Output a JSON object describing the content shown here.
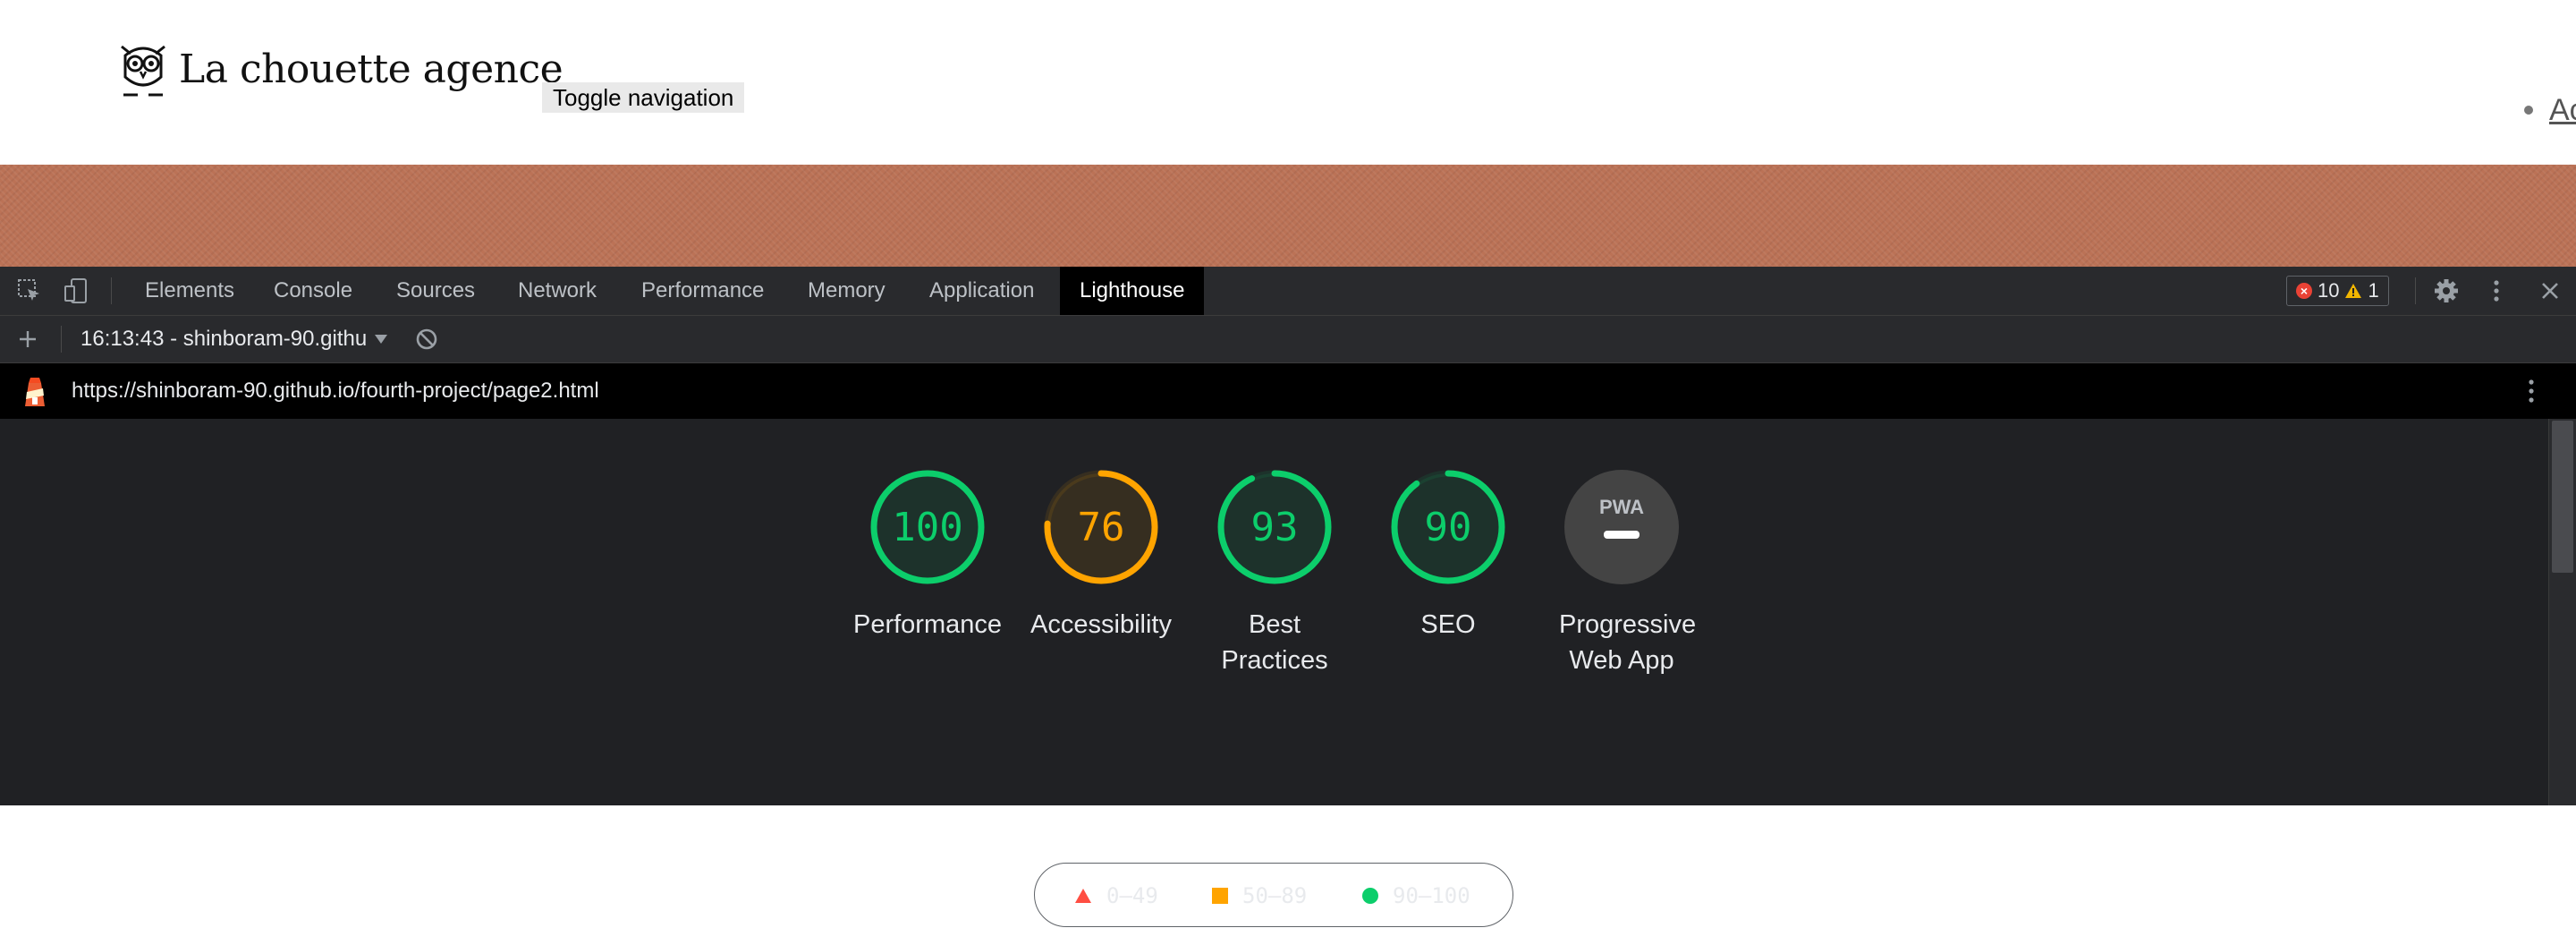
{
  "site": {
    "logo_text": "La chouette agence",
    "toggle_label": "Toggle navigation",
    "nav_partial": "Ac"
  },
  "devtools": {
    "tabs": [
      "Elements",
      "Console",
      "Sources",
      "Network",
      "Performance",
      "Memory",
      "Application",
      "Lighthouse"
    ],
    "active_tab": "Lighthouse",
    "errors": "10",
    "warnings": "1",
    "report_select": "16:13:43 - shinboram-90.github.io",
    "url": "https://shinboram-90.github.io/fourth-project/page2.html"
  },
  "lighthouse": {
    "categories": [
      {
        "label": "Performance",
        "score": "100",
        "value": 100,
        "color": "#0cce6b"
      },
      {
        "label": "Accessibility",
        "score": "76",
        "value": 76,
        "color": "#ffa400"
      },
      {
        "label": "Best Practices",
        "score": "93",
        "value": 93,
        "color": "#0cce6b"
      },
      {
        "label": "SEO",
        "score": "90",
        "value": 90,
        "color": "#0cce6b"
      },
      {
        "label": "Progressive Web App",
        "score": "",
        "value": null,
        "color": "#9aa0a6",
        "badge": "PWA"
      }
    ],
    "legend": [
      {
        "label": "0–49",
        "shape": "triangle",
        "color": "#ff4e42"
      },
      {
        "label": "50–89",
        "shape": "square",
        "color": "#ffa400"
      },
      {
        "label": "90–100",
        "shape": "circle",
        "color": "#0cce6b"
      }
    ]
  }
}
